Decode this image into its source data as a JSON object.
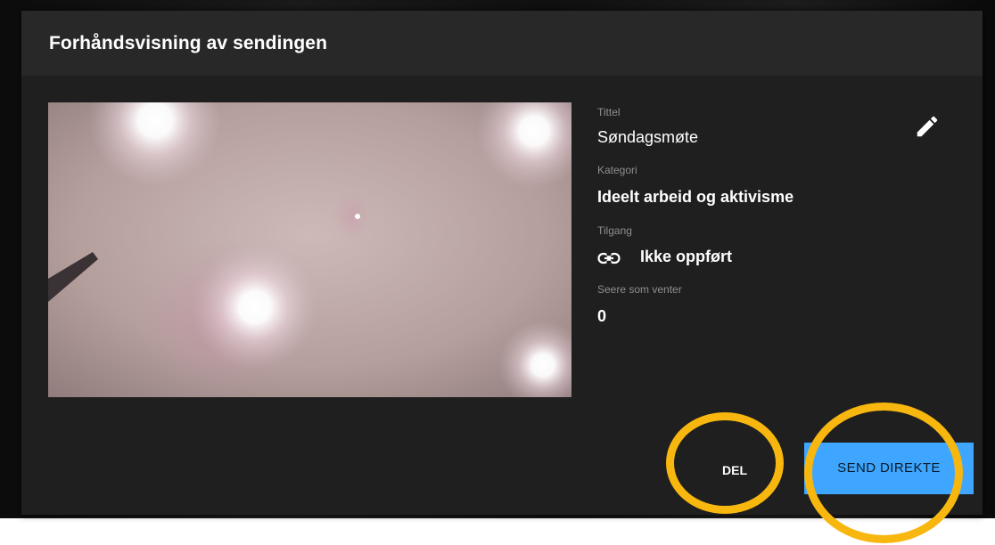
{
  "dialog": {
    "title": "Forhåndsvisning av sendingen"
  },
  "preview": {
    "icon": "camera-preview"
  },
  "details": {
    "title_label": "Tittel",
    "title_value": "Søndagsmøte",
    "category_label": "Kategori",
    "category_value": "Ideelt arbeid og aktivisme",
    "access_label": "Tilgang",
    "access_value": "Ikke oppført",
    "access_icon": "link-icon",
    "waiting_label": "Seere som venter",
    "waiting_value": "0",
    "edit_icon": "pencil-icon"
  },
  "actions": {
    "share_label": "DEL",
    "go_live_label": "SEND DIREKTE"
  },
  "colors": {
    "dialog_bg": "#1f1f1f",
    "header_bg": "#282828",
    "primary_button": "#3ea6ff",
    "highlight": "#f8b70f"
  }
}
